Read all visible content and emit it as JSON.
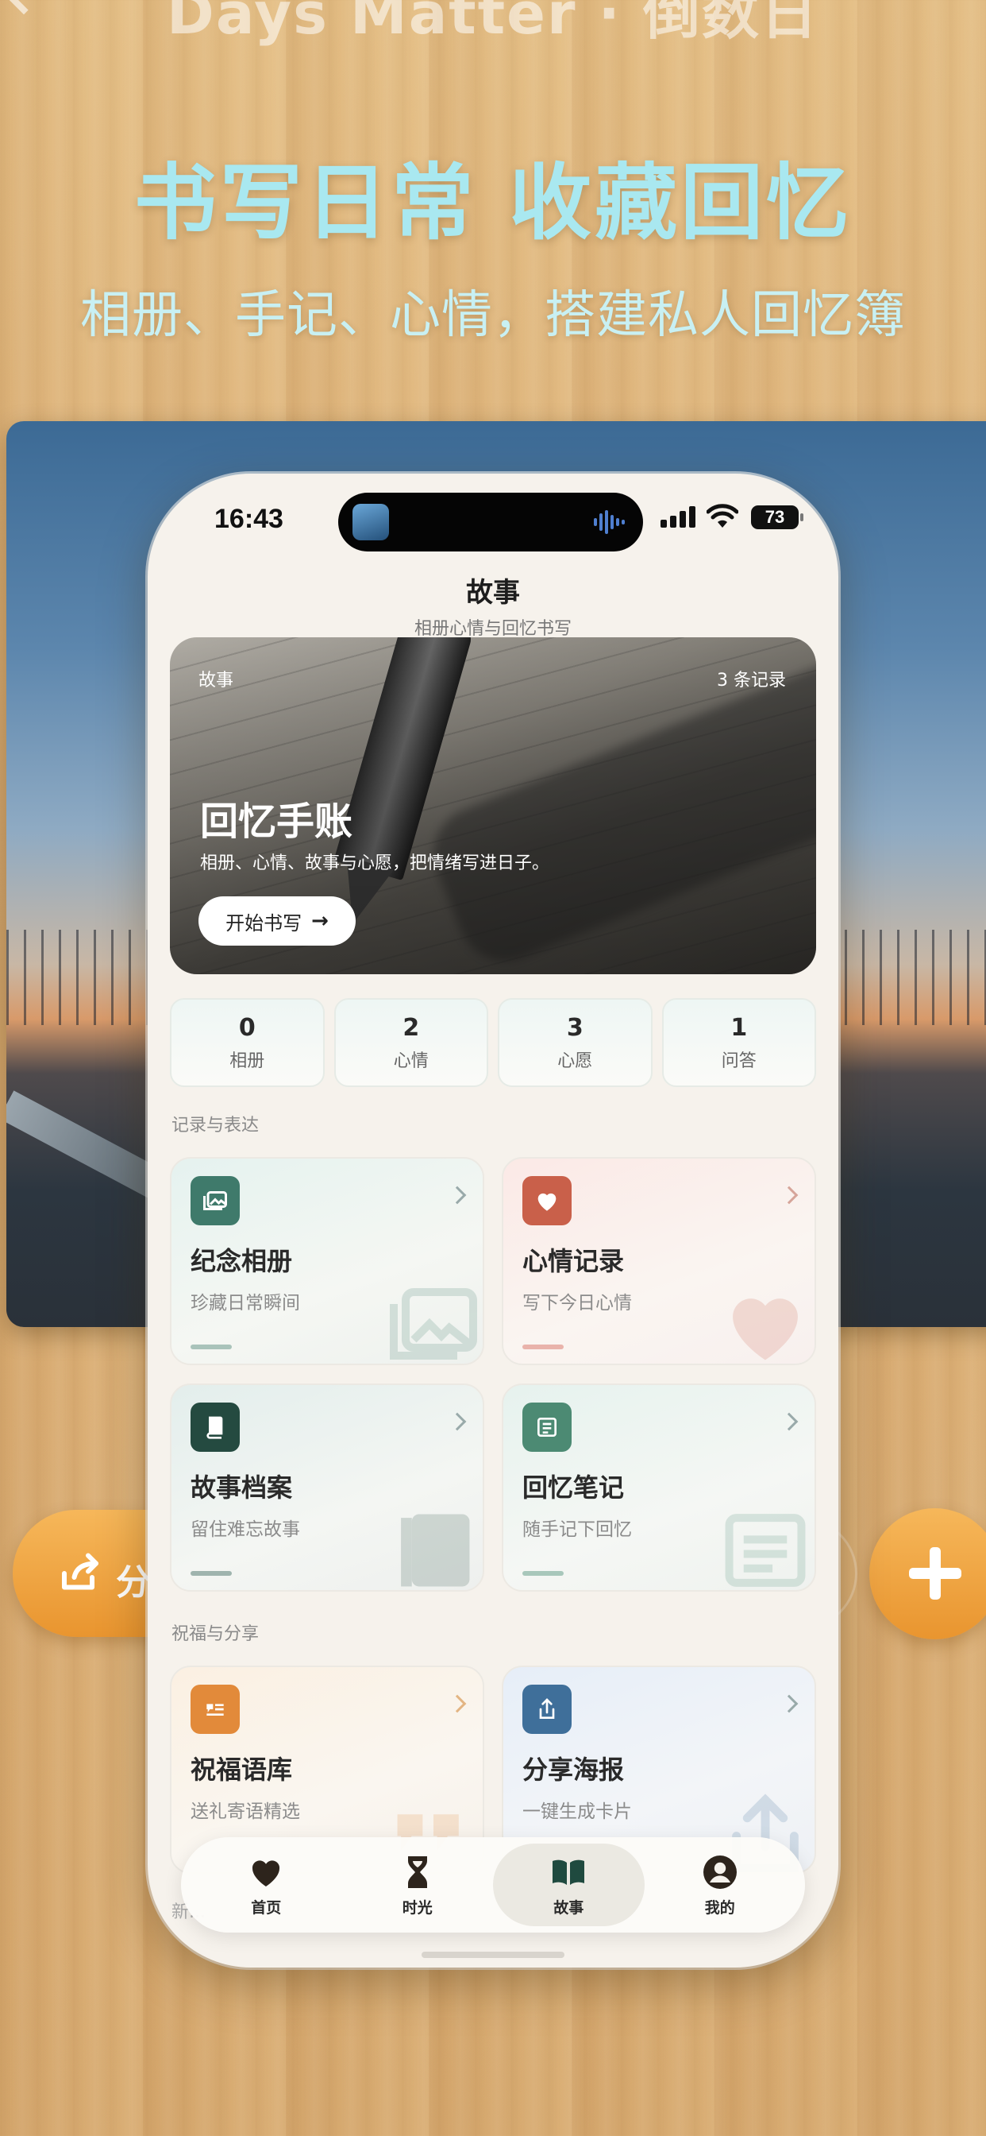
{
  "background": {
    "faint_title": "Days Matter · 倒数日",
    "hero_title": "书写日常 收藏回忆",
    "hero_subtitle": "相册、手记、心情，搭建私人回忆簿",
    "share_label": "分",
    "colors": {
      "hero_title": "#a9e8f0",
      "accent_orange": "#f0a03c"
    }
  },
  "status_bar": {
    "time": "16:43",
    "battery": "73"
  },
  "header": {
    "title": "故事",
    "subtitle": "相册心情与回忆书写"
  },
  "banner": {
    "tag": "故事",
    "count": "3 条记录",
    "title": "回忆手账",
    "description": "相册、心情、故事与心愿，把情绪写进日子。",
    "button_label": "开始书写",
    "button_arrow": "→"
  },
  "stats": [
    {
      "value": "0",
      "label": "相册"
    },
    {
      "value": "2",
      "label": "心情"
    },
    {
      "value": "3",
      "label": "心愿"
    },
    {
      "value": "1",
      "label": "问答"
    }
  ],
  "sections": {
    "record": "记录与表达",
    "share": "祝福与分享",
    "peek": "新..."
  },
  "cards": [
    {
      "title": "纪念相册",
      "subtitle": "珍藏日常瞬间",
      "icon": "photo-album-icon",
      "color": "#3f7a6b"
    },
    {
      "title": "心情记录",
      "subtitle": "写下今日心情",
      "icon": "heart-icon",
      "color": "#c9604a"
    },
    {
      "title": "故事档案",
      "subtitle": "留住难忘故事",
      "icon": "book-icon",
      "color": "#244a40"
    },
    {
      "title": "回忆笔记",
      "subtitle": "随手记下回忆",
      "icon": "note-icon",
      "color": "#4c8a73"
    },
    {
      "title": "祝福语库",
      "subtitle": "送礼寄语精选",
      "icon": "quote-icon",
      "color": "#e28a3a"
    },
    {
      "title": "分享海报",
      "subtitle": "一键生成卡片",
      "icon": "share-icon",
      "color": "#3f6f9a"
    }
  ],
  "tabbar": [
    {
      "label": "首页",
      "icon": "heart-icon"
    },
    {
      "label": "时光",
      "icon": "hourglass-icon"
    },
    {
      "label": "故事",
      "icon": "book-open-icon",
      "active": true
    },
    {
      "label": "我的",
      "icon": "profile-icon"
    }
  ]
}
